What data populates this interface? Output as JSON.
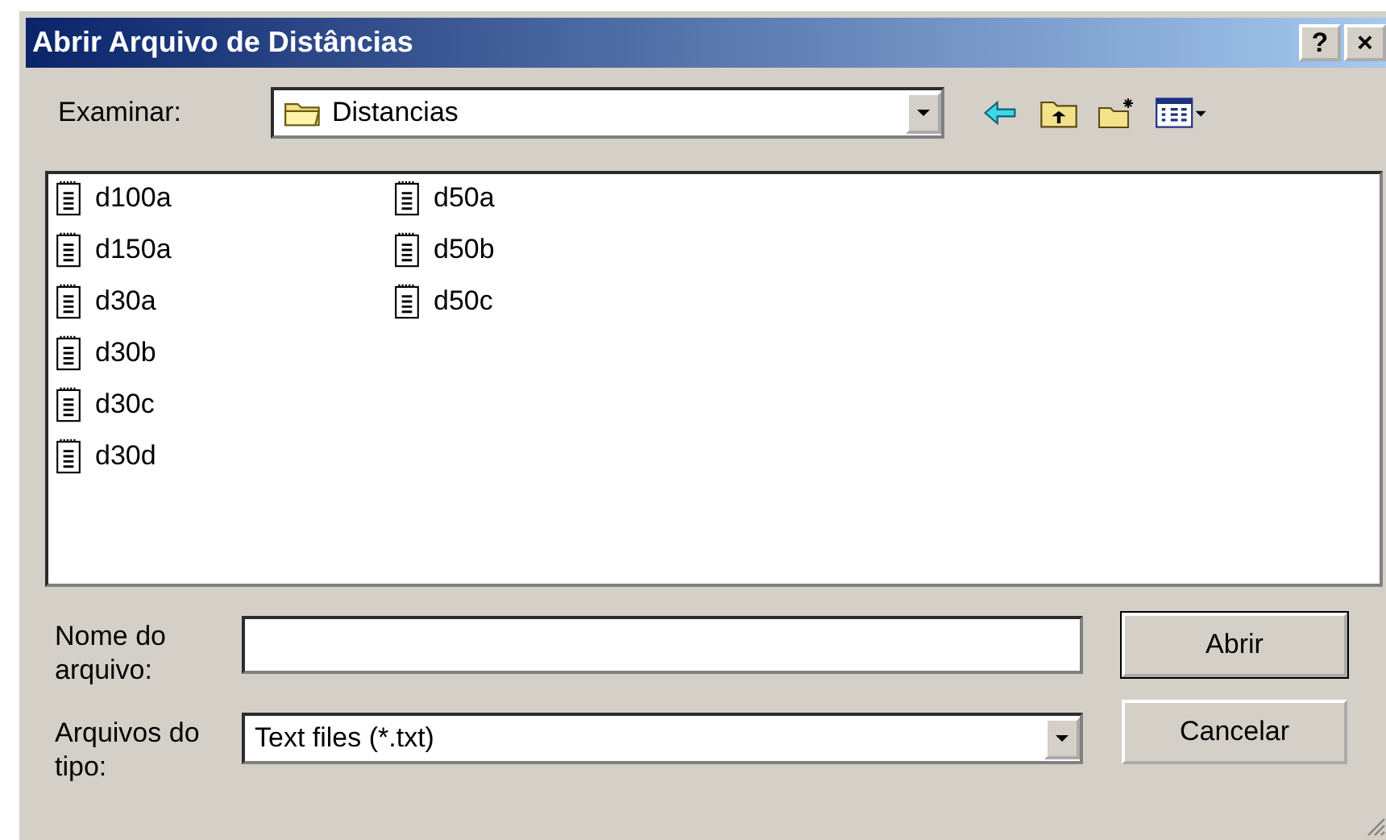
{
  "window": {
    "title": "Abrir Arquivo de Distâncias",
    "title_buttons": [
      "?",
      "×"
    ]
  },
  "look_in": {
    "label": "Examinar:",
    "value": "Distancias"
  },
  "files": [
    {
      "name": "d100a",
      "selected": false
    },
    {
      "name": "d150a",
      "selected": false
    },
    {
      "name": "d30a",
      "selected": false
    },
    {
      "name": "d30b",
      "selected": false
    },
    {
      "name": "d30c",
      "selected": false
    },
    {
      "name": "d30d",
      "selected": false
    },
    {
      "name": "d50a",
      "selected": false
    },
    {
      "name": "d50b",
      "selected": false
    },
    {
      "name": "d50c",
      "selected": false
    }
  ],
  "file_name": {
    "label": "Nome do arquivo:"
  },
  "file_type": {
    "label": "Arquivos do tipo:",
    "value": "Text files (*.txt)"
  },
  "buttons": [
    {
      "label": "Abrir",
      "default": true
    },
    {
      "label": "Cancelar",
      "default": false
    }
  ]
}
